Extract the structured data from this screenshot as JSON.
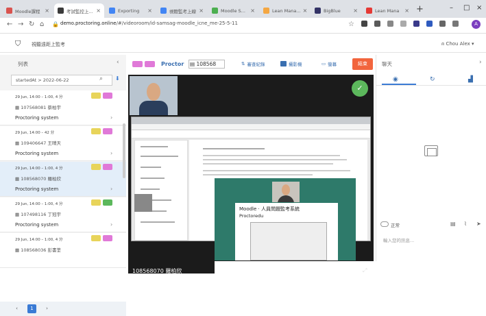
{
  "browser": {
    "tabs": [
      {
        "label": "Moodle課程",
        "color": "#d9534f"
      },
      {
        "label": "考試監控上...",
        "color": "#3a3a3a"
      },
      {
        "label": "Exporting",
        "color": "#4285f4"
      },
      {
        "label": "視聽監考上線",
        "color": "#4285f4"
      },
      {
        "label": "Moodle S...",
        "color": "#4caf50"
      },
      {
        "label": "Lean Mana...",
        "color": "#f4a742"
      },
      {
        "label": "BigBlue",
        "color": "#333366"
      },
      {
        "label": "Lean Mana",
        "color": "#e53935"
      }
    ],
    "new_tab": "+",
    "url_host": "demo.proctoring.online",
    "url_path": "/#/videoroom/id-samsag-moodle_icne_me-25-5-11",
    "avatar_letter": "A"
  },
  "header": {
    "site_name": "視聽遠距上監考",
    "user": "Chou Alex"
  },
  "left": {
    "title": "列表",
    "filter": "startedAt > 2022-06-22",
    "entries": [
      {
        "time": "29 Jun, 14:00 – 1:00, 4 分",
        "student": "107568081 蔡柏宇",
        "system": "Proctoring system",
        "tags": [
          "#e8d45a",
          "#e079d8"
        ]
      },
      {
        "time": "29 Jun, 14:00 – 42 分",
        "student": "109406647 王晴天",
        "system": "Proctoring system",
        "tags": [
          "#e8d45a",
          "#e079d8"
        ]
      },
      {
        "time": "29 Jun, 14:00 – 1:00, 4 分",
        "student": "108568070 羅柏欣",
        "system": "Proctoring system",
        "tags": [
          "#e8d45a",
          "#e079d8"
        ],
        "selected": true
      },
      {
        "time": "29 Jun, 14:00 – 1:00, 4 分",
        "student": "107498116 丁冠宇",
        "system": "Proctoring system",
        "tags": [
          "#e8d45a",
          "#5cb85c"
        ]
      },
      {
        "time": "29 Jun, 14:00 – 1:00, 4 分",
        "student": "108568036 彭書荃",
        "system": "",
        "tags": [
          "#e8d45a",
          "#e079d8"
        ]
      }
    ],
    "pages": [
      "1"
    ]
  },
  "center": {
    "title": "Proctor",
    "session_id": "108568",
    "buttons": [
      "審查紀錄",
      "攝影機",
      "螢幕"
    ],
    "end_label": "結束",
    "bottom_label": "108568070 羅柏欣",
    "slide_title": "Moodle · 人員問題監考系統",
    "slide_subtitle": "Proctoredu",
    "tag_colors": [
      "#e079d8",
      "#e079d8"
    ]
  },
  "right": {
    "title": "聊天",
    "toggle_label": "正常",
    "input_placeholder": "輸入您的訊息..."
  }
}
